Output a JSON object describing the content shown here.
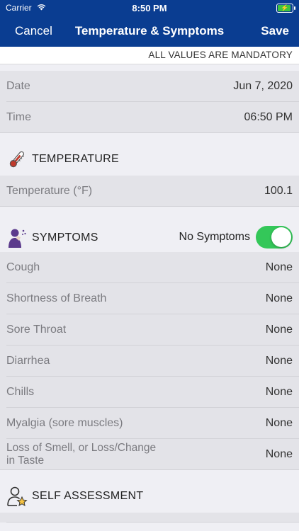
{
  "status_bar": {
    "carrier": "Carrier",
    "time": "8:50 PM"
  },
  "nav": {
    "cancel": "Cancel",
    "title": "Temperature & Symptoms",
    "save": "Save"
  },
  "mandatory_note": "ALL VALUES ARE MANDATORY",
  "datetime": {
    "date_label": "Date",
    "date_value": "Jun 7, 2020",
    "time_label": "Time",
    "time_value": "06:50 PM"
  },
  "temperature": {
    "header": "TEMPERATURE",
    "label": "Temperature (°F)",
    "value": "100.1"
  },
  "symptoms": {
    "header": "SYMPTOMS",
    "no_symptoms_label": "No Symptoms",
    "no_symptoms_on": true,
    "items": [
      {
        "label": "Cough",
        "value": "None"
      },
      {
        "label": "Shortness of Breath",
        "value": "None"
      },
      {
        "label": "Sore Throat",
        "value": "None"
      },
      {
        "label": "Diarrhea",
        "value": "None"
      },
      {
        "label": "Chills",
        "value": "None"
      },
      {
        "label": "Myalgia (sore muscles)",
        "value": "None"
      },
      {
        "label_line1": "Loss of Smell, or Loss/Change",
        "label_line2": "in Taste",
        "value": "None"
      }
    ]
  },
  "self_assessment": {
    "header": "SELF ASSESSMENT"
  },
  "colors": {
    "nav_blue": "#0a3d91",
    "toggle_green": "#34c759",
    "thermometer_red": "#c0392b",
    "icon_purple": "#5b3a8c"
  }
}
